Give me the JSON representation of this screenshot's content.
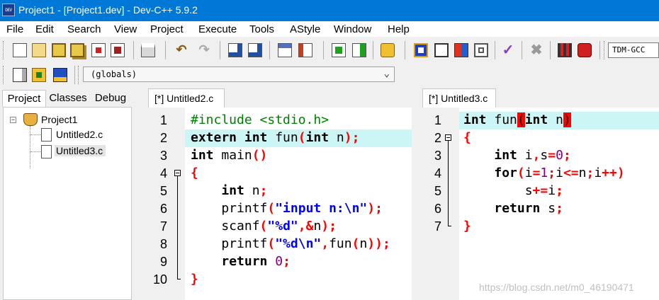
{
  "window": {
    "title": "Project1 - [Project1.dev] - Dev-C++ 5.9.2",
    "icon_text": "DEV"
  },
  "menu": [
    "File",
    "Edit",
    "Search",
    "View",
    "Project",
    "Execute",
    "Tools",
    "AStyle",
    "Window",
    "Help"
  ],
  "toolbar": {
    "compiler": "TDM-GCC"
  },
  "scope": {
    "value": "(globals)"
  },
  "left_panel": {
    "tabs": [
      "Project",
      "Classes",
      "Debug"
    ],
    "tree": {
      "root": "Project1",
      "files": [
        "Untitled2.c",
        "Untitled3.c"
      ]
    }
  },
  "editor_left": {
    "tab": "[*] Untitled2.c",
    "lines": [
      {
        "num": "1",
        "code": "#include <stdio.h>"
      },
      {
        "num": "2",
        "code": "extern int fun(int n);"
      },
      {
        "num": "3",
        "code": "int main()"
      },
      {
        "num": "4",
        "code": "{"
      },
      {
        "num": "5",
        "code": "    int n;"
      },
      {
        "num": "6",
        "code": "    printf(\"input n:\\n\");"
      },
      {
        "num": "7",
        "code": "    scanf(\"%d\",&n);"
      },
      {
        "num": "8",
        "code": "    printf(\"%d\\n\",fun(n));"
      },
      {
        "num": "9",
        "code": "    return 0;"
      },
      {
        "num": "10",
        "code": "}"
      }
    ]
  },
  "editor_right": {
    "tab": "[*] Untitled3.c",
    "lines": [
      {
        "num": "1",
        "code": "int fun(int n)"
      },
      {
        "num": "2",
        "code": "{"
      },
      {
        "num": "3",
        "code": "    int i,s=0;"
      },
      {
        "num": "4",
        "code": "    for(i=1;i<=n;i++)"
      },
      {
        "num": "5",
        "code": "        s+=i;"
      },
      {
        "num": "6",
        "code": "    return s;"
      },
      {
        "num": "7",
        "code": "}"
      }
    ]
  },
  "watermark": "https://blog.csdn.net/m0_46190471"
}
